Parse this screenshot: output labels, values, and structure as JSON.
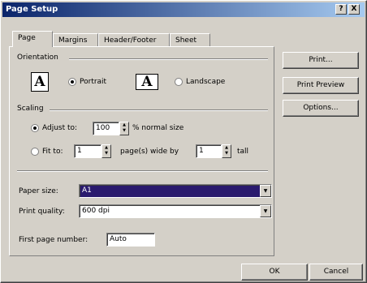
{
  "window": {
    "title": "Page Setup",
    "help_label": "?",
    "close_label": "X"
  },
  "tabs": [
    "Page",
    "Margins",
    "Header/Footer",
    "Sheet"
  ],
  "orientation": {
    "group_label": "Orientation",
    "portrait_label": "Portrait",
    "landscape_label": "Landscape",
    "icon_glyph": "A",
    "selected": "Portrait"
  },
  "scaling": {
    "group_label": "Scaling",
    "adjust_label": "Adjust to:",
    "adjust_value": "100",
    "adjust_suffix": "% normal size",
    "fit_label": "Fit to:",
    "fit_wide_value": "1",
    "fit_wide_suffix": "page(s) wide by",
    "fit_tall_value": "1",
    "fit_tall_suffix": "tall",
    "selected": "Adjust to"
  },
  "paper_size": {
    "label": "Paper size:",
    "value": "A1"
  },
  "print_quality": {
    "label": "Print quality:",
    "value": "600 dpi"
  },
  "first_page": {
    "label": "First page number:",
    "value": "Auto"
  },
  "side_buttons": {
    "print": "Print...",
    "preview": "Print Preview",
    "options": "Options..."
  },
  "footer": {
    "ok": "OK",
    "cancel": "Cancel"
  },
  "colors": {
    "title_start": "#0a246a",
    "title_end": "#a6caf0",
    "selection": "#2a1a6e",
    "face": "#d4d0c8"
  }
}
